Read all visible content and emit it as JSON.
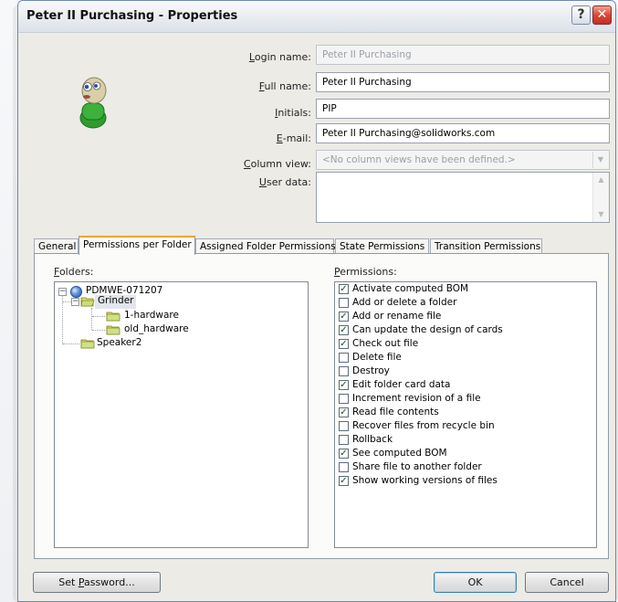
{
  "window": {
    "title": "Peter II Purchasing - Properties",
    "help_label": "?",
    "close_label": "✕"
  },
  "form": {
    "login_label": "Login name:",
    "login_value": "Peter II Purchasing",
    "fullname_label": "Full name:",
    "fullname_value": "Peter II Purchasing",
    "initials_label": "Initials:",
    "initials_value": "PIP",
    "email_label": "E-mail:",
    "email_value": "Peter II Purchasing@solidworks.com",
    "columnview_label": "Column view:",
    "columnview_value": "<No column views have been defined.>",
    "userdata_label": "User data:",
    "userdata_value": ""
  },
  "tabs": [
    {
      "label": "General"
    },
    {
      "label": "Permissions per Folder"
    },
    {
      "label": "Assigned Folder Permissions"
    },
    {
      "label": "State Permissions"
    },
    {
      "label": "Transition Permissions"
    }
  ],
  "folders": {
    "title": "Folders:",
    "root": "PDMWE-071207",
    "items": [
      "Grinder",
      "1-hardware",
      "old_hardware",
      "Speaker2"
    ]
  },
  "permissions": {
    "title": "Permissions:",
    "items": [
      {
        "label": "Activate computed BOM",
        "checked": true
      },
      {
        "label": "Add or delete a folder",
        "checked": false
      },
      {
        "label": "Add or rename file",
        "checked": true
      },
      {
        "label": "Can update the design of cards",
        "checked": true
      },
      {
        "label": "Check out file",
        "checked": true
      },
      {
        "label": "Delete file",
        "checked": false
      },
      {
        "label": "Destroy",
        "checked": false
      },
      {
        "label": "Edit folder card data",
        "checked": true
      },
      {
        "label": "Increment revision of a file",
        "checked": false
      },
      {
        "label": "Read file contents",
        "checked": true
      },
      {
        "label": "Recover files from recycle bin",
        "checked": false
      },
      {
        "label": "Rollback",
        "checked": false
      },
      {
        "label": "See computed BOM",
        "checked": true
      },
      {
        "label": "Share file to another folder",
        "checked": false
      },
      {
        "label": "Show working versions of files",
        "checked": true
      }
    ]
  },
  "buttons": {
    "set_password": "Set Password...",
    "ok": "OK",
    "cancel": "Cancel"
  },
  "colors": {
    "title_bg": "#e9ecf1",
    "tab_accent": "#f3a23a",
    "dialog_bg": "#ecebe6"
  }
}
